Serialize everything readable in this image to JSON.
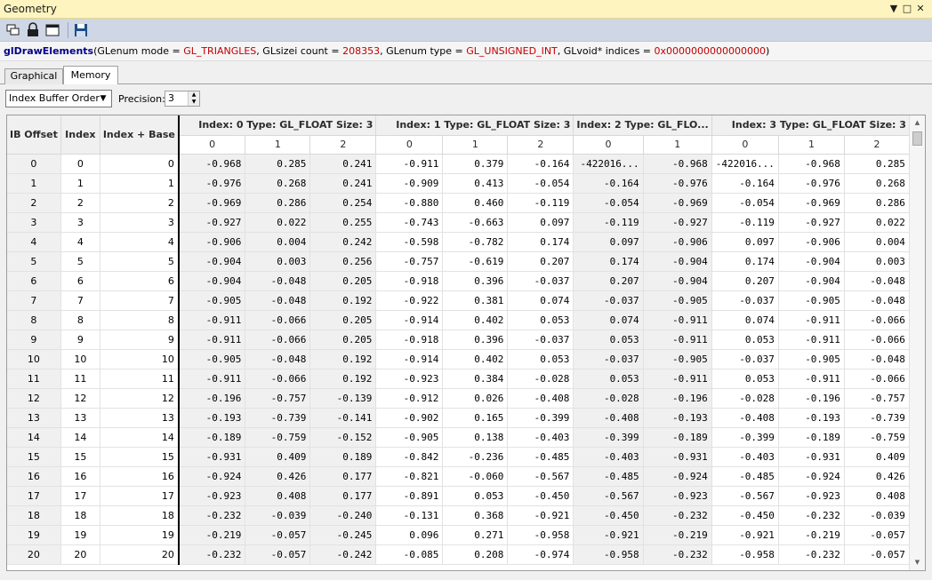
{
  "window": {
    "title": "Geometry"
  },
  "toolbar": {
    "icons": [
      "copy-windows-icon",
      "lock-icon",
      "window-icon",
      "save-icon"
    ]
  },
  "call": {
    "fn": "glDrawElements",
    "p1": "(GLenum mode = ",
    "v1": "GL_TRIANGLES",
    "p2": ", GLsizei count = ",
    "v2": "208353",
    "p3": ", GLenum type = ",
    "v3": "GL_UNSIGNED_INT",
    "p4": ", GLvoid* indices = ",
    "v4": "0x0000000000000000",
    "p5": ")"
  },
  "tabs": [
    {
      "label": "Graphical"
    },
    {
      "label": "Memory"
    }
  ],
  "options": {
    "order": "Index Buffer Order",
    "precision_label": "Precision:",
    "precision": "3"
  },
  "grid": {
    "headers": [
      "IB Offset",
      "Index",
      "Index + Base",
      "Index: 0 Type: GL_FLOAT Size: 3",
      "Index: 1 Type: GL_FLOAT Size: 3",
      "Index: 2 Type: GL_FLO...",
      "Index: 3 Type: GL_FLOAT Size: 3"
    ],
    "subheaders": [
      "0",
      "1",
      "2",
      "0",
      "1",
      "2",
      "0",
      "1",
      "0",
      "1",
      "2"
    ],
    "rows": [
      [
        "0",
        "0",
        "0",
        "-0.968",
        "0.285",
        "0.241",
        "-0.911",
        "0.379",
        "-0.164",
        "-422016...",
        "-0.968",
        "-422016...",
        "-0.968",
        "0.285"
      ],
      [
        "1",
        "1",
        "1",
        "-0.976",
        "0.268",
        "0.241",
        "-0.909",
        "0.413",
        "-0.054",
        "-0.164",
        "-0.976",
        "-0.164",
        "-0.976",
        "0.268"
      ],
      [
        "2",
        "2",
        "2",
        "-0.969",
        "0.286",
        "0.254",
        "-0.880",
        "0.460",
        "-0.119",
        "-0.054",
        "-0.969",
        "-0.054",
        "-0.969",
        "0.286"
      ],
      [
        "3",
        "3",
        "3",
        "-0.927",
        "0.022",
        "0.255",
        "-0.743",
        "-0.663",
        "0.097",
        "-0.119",
        "-0.927",
        "-0.119",
        "-0.927",
        "0.022"
      ],
      [
        "4",
        "4",
        "4",
        "-0.906",
        "0.004",
        "0.242",
        "-0.598",
        "-0.782",
        "0.174",
        "0.097",
        "-0.906",
        "0.097",
        "-0.906",
        "0.004"
      ],
      [
        "5",
        "5",
        "5",
        "-0.904",
        "0.003",
        "0.256",
        "-0.757",
        "-0.619",
        "0.207",
        "0.174",
        "-0.904",
        "0.174",
        "-0.904",
        "0.003"
      ],
      [
        "6",
        "6",
        "6",
        "-0.904",
        "-0.048",
        "0.205",
        "-0.918",
        "0.396",
        "-0.037",
        "0.207",
        "-0.904",
        "0.207",
        "-0.904",
        "-0.048"
      ],
      [
        "7",
        "7",
        "7",
        "-0.905",
        "-0.048",
        "0.192",
        "-0.922",
        "0.381",
        "0.074",
        "-0.037",
        "-0.905",
        "-0.037",
        "-0.905",
        "-0.048"
      ],
      [
        "8",
        "8",
        "8",
        "-0.911",
        "-0.066",
        "0.205",
        "-0.914",
        "0.402",
        "0.053",
        "0.074",
        "-0.911",
        "0.074",
        "-0.911",
        "-0.066"
      ],
      [
        "9",
        "9",
        "9",
        "-0.911",
        "-0.066",
        "0.205",
        "-0.918",
        "0.396",
        "-0.037",
        "0.053",
        "-0.911",
        "0.053",
        "-0.911",
        "-0.066"
      ],
      [
        "10",
        "10",
        "10",
        "-0.905",
        "-0.048",
        "0.192",
        "-0.914",
        "0.402",
        "0.053",
        "-0.037",
        "-0.905",
        "-0.037",
        "-0.905",
        "-0.048"
      ],
      [
        "11",
        "11",
        "11",
        "-0.911",
        "-0.066",
        "0.192",
        "-0.923",
        "0.384",
        "-0.028",
        "0.053",
        "-0.911",
        "0.053",
        "-0.911",
        "-0.066"
      ],
      [
        "12",
        "12",
        "12",
        "-0.196",
        "-0.757",
        "-0.139",
        "-0.912",
        "0.026",
        "-0.408",
        "-0.028",
        "-0.196",
        "-0.028",
        "-0.196",
        "-0.757"
      ],
      [
        "13",
        "13",
        "13",
        "-0.193",
        "-0.739",
        "-0.141",
        "-0.902",
        "0.165",
        "-0.399",
        "-0.408",
        "-0.193",
        "-0.408",
        "-0.193",
        "-0.739"
      ],
      [
        "14",
        "14",
        "14",
        "-0.189",
        "-0.759",
        "-0.152",
        "-0.905",
        "0.138",
        "-0.403",
        "-0.399",
        "-0.189",
        "-0.399",
        "-0.189",
        "-0.759"
      ],
      [
        "15",
        "15",
        "15",
        "-0.931",
        "0.409",
        "0.189",
        "-0.842",
        "-0.236",
        "-0.485",
        "-0.403",
        "-0.931",
        "-0.403",
        "-0.931",
        "0.409"
      ],
      [
        "16",
        "16",
        "16",
        "-0.924",
        "0.426",
        "0.177",
        "-0.821",
        "-0.060",
        "-0.567",
        "-0.485",
        "-0.924",
        "-0.485",
        "-0.924",
        "0.426"
      ],
      [
        "17",
        "17",
        "17",
        "-0.923",
        "0.408",
        "0.177",
        "-0.891",
        "0.053",
        "-0.450",
        "-0.567",
        "-0.923",
        "-0.567",
        "-0.923",
        "0.408"
      ],
      [
        "18",
        "18",
        "18",
        "-0.232",
        "-0.039",
        "-0.240",
        "-0.131",
        "0.368",
        "-0.921",
        "-0.450",
        "-0.232",
        "-0.450",
        "-0.232",
        "-0.039"
      ],
      [
        "19",
        "19",
        "19",
        "-0.219",
        "-0.057",
        "-0.245",
        "0.096",
        "0.271",
        "-0.958",
        "-0.921",
        "-0.219",
        "-0.921",
        "-0.219",
        "-0.057"
      ],
      [
        "20",
        "20",
        "20",
        "-0.232",
        "-0.057",
        "-0.242",
        "-0.085",
        "0.208",
        "-0.974",
        "-0.958",
        "-0.232",
        "-0.958",
        "-0.232",
        "-0.057"
      ]
    ]
  }
}
